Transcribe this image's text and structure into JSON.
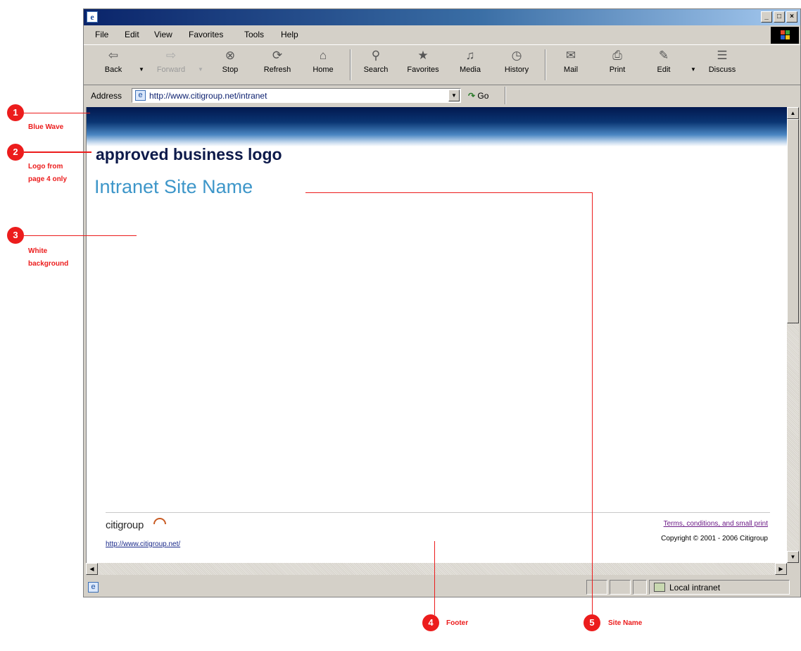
{
  "browser": {
    "menu": [
      "File",
      "Edit",
      "View",
      "Favorites",
      "Tools",
      "Help"
    ],
    "toolbar": [
      {
        "label": "Back",
        "icon": "back-arrow-icon",
        "glyph": "⇦",
        "disabled": false
      },
      {
        "label": "Forward",
        "icon": "forward-arrow-icon",
        "glyph": "⇨",
        "disabled": true
      },
      {
        "label": "Stop",
        "icon": "stop-icon",
        "glyph": "⊗",
        "disabled": false
      },
      {
        "label": "Refresh",
        "icon": "refresh-icon",
        "glyph": "⟳",
        "disabled": false
      },
      {
        "label": "Home",
        "icon": "home-icon",
        "glyph": "⌂",
        "disabled": false
      },
      {
        "label": "Search",
        "icon": "search-icon",
        "glyph": "⚲",
        "disabled": false
      },
      {
        "label": "Favorites",
        "icon": "favorites-icon",
        "glyph": "★",
        "disabled": false
      },
      {
        "label": "Media",
        "icon": "media-icon",
        "glyph": "♫",
        "disabled": false
      },
      {
        "label": "History",
        "icon": "history-icon",
        "glyph": "◷",
        "disabled": false
      },
      {
        "label": "Mail",
        "icon": "mail-icon",
        "glyph": "✉",
        "disabled": false
      },
      {
        "label": "Print",
        "icon": "print-icon",
        "glyph": "⎙",
        "disabled": false
      },
      {
        "label": "Edit",
        "icon": "edit-icon",
        "glyph": "✎",
        "disabled": false
      },
      {
        "label": "Discuss",
        "icon": "discuss-icon",
        "glyph": "☰",
        "disabled": false
      }
    ],
    "address_label": "Address",
    "address_url": "http://www.citigroup.net/intranet",
    "go_label": "Go",
    "status_zone": "Local intranet"
  },
  "page": {
    "logo_text": "approved business logo",
    "site_name": "Intranet Site Name",
    "footer": {
      "brand": "citigroup",
      "link": "http://www.citigroup.net/",
      "terms": "Terms, conditions, and small print",
      "copyright": "Copyright © 2001 - 2006 Citigroup"
    }
  },
  "annotations": [
    {
      "number": "1",
      "label": "Blue Wave"
    },
    {
      "number": "2",
      "label": "Logo from page 4 only"
    },
    {
      "number": "3",
      "label": "White background"
    },
    {
      "number": "4",
      "label": "Footer"
    },
    {
      "number": "5",
      "label": "Site Name"
    }
  ],
  "colors": {
    "annotation": "#ec1c1c",
    "site_name": "#3d96c9",
    "logo_text": "#0d1a4a",
    "wave_dark": "#02184f"
  }
}
